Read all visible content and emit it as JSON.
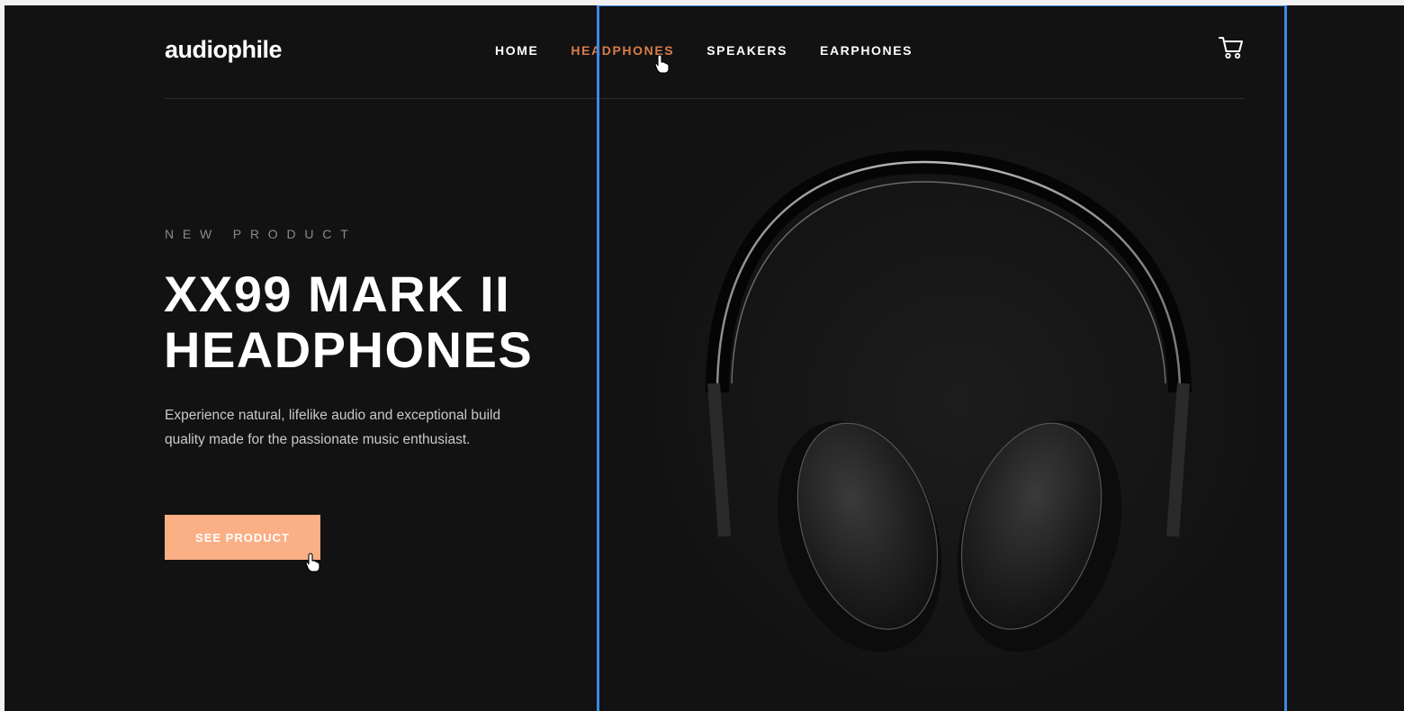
{
  "header": {
    "logo": "audiophile",
    "nav": [
      {
        "label": "HOME",
        "active": false
      },
      {
        "label": "HEADPHONES",
        "active": true
      },
      {
        "label": "SPEAKERS",
        "active": false
      },
      {
        "label": "EARPHONES",
        "active": false
      }
    ],
    "cart_icon": "cart-icon"
  },
  "hero": {
    "overline": "NEW PRODUCT",
    "title_line1": "XX99 MARK II",
    "title_line2": "HEADPHONES",
    "description": "Experience natural, lifelike audio and exceptional build quality made for the passionate music enthusiast.",
    "cta_label": "SEE PRODUCT",
    "image_alt": "headphones-image"
  },
  "colors": {
    "background": "#121212",
    "accent": "#d87d4a",
    "button": "#fbaf85",
    "selection": "#3d8ae6"
  }
}
